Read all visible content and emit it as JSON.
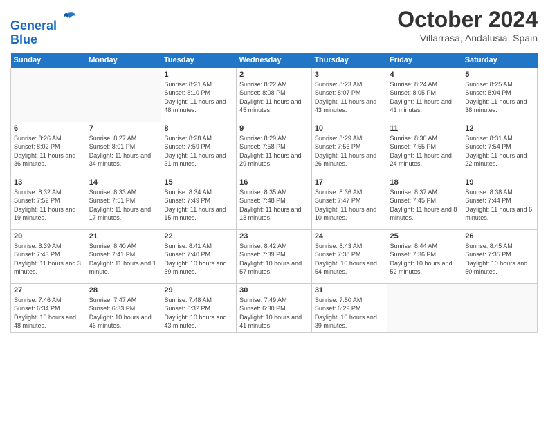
{
  "header": {
    "logo_line1": "General",
    "logo_line2": "Blue",
    "title": "October 2024",
    "subtitle": "Villarrasa, Andalusia, Spain"
  },
  "days_of_week": [
    "Sunday",
    "Monday",
    "Tuesday",
    "Wednesday",
    "Thursday",
    "Friday",
    "Saturday"
  ],
  "weeks": [
    [
      {
        "day": "",
        "info": ""
      },
      {
        "day": "",
        "info": ""
      },
      {
        "day": "1",
        "info": "Sunrise: 8:21 AM\nSunset: 8:10 PM\nDaylight: 11 hours and 48 minutes."
      },
      {
        "day": "2",
        "info": "Sunrise: 8:22 AM\nSunset: 8:08 PM\nDaylight: 11 hours and 45 minutes."
      },
      {
        "day": "3",
        "info": "Sunrise: 8:23 AM\nSunset: 8:07 PM\nDaylight: 11 hours and 43 minutes."
      },
      {
        "day": "4",
        "info": "Sunrise: 8:24 AM\nSunset: 8:05 PM\nDaylight: 11 hours and 41 minutes."
      },
      {
        "day": "5",
        "info": "Sunrise: 8:25 AM\nSunset: 8:04 PM\nDaylight: 11 hours and 38 minutes."
      }
    ],
    [
      {
        "day": "6",
        "info": "Sunrise: 8:26 AM\nSunset: 8:02 PM\nDaylight: 11 hours and 36 minutes."
      },
      {
        "day": "7",
        "info": "Sunrise: 8:27 AM\nSunset: 8:01 PM\nDaylight: 11 hours and 34 minutes."
      },
      {
        "day": "8",
        "info": "Sunrise: 8:28 AM\nSunset: 7:59 PM\nDaylight: 11 hours and 31 minutes."
      },
      {
        "day": "9",
        "info": "Sunrise: 8:29 AM\nSunset: 7:58 PM\nDaylight: 11 hours and 29 minutes."
      },
      {
        "day": "10",
        "info": "Sunrise: 8:29 AM\nSunset: 7:56 PM\nDaylight: 11 hours and 26 minutes."
      },
      {
        "day": "11",
        "info": "Sunrise: 8:30 AM\nSunset: 7:55 PM\nDaylight: 11 hours and 24 minutes."
      },
      {
        "day": "12",
        "info": "Sunrise: 8:31 AM\nSunset: 7:54 PM\nDaylight: 11 hours and 22 minutes."
      }
    ],
    [
      {
        "day": "13",
        "info": "Sunrise: 8:32 AM\nSunset: 7:52 PM\nDaylight: 11 hours and 19 minutes."
      },
      {
        "day": "14",
        "info": "Sunrise: 8:33 AM\nSunset: 7:51 PM\nDaylight: 11 hours and 17 minutes."
      },
      {
        "day": "15",
        "info": "Sunrise: 8:34 AM\nSunset: 7:49 PM\nDaylight: 11 hours and 15 minutes."
      },
      {
        "day": "16",
        "info": "Sunrise: 8:35 AM\nSunset: 7:48 PM\nDaylight: 11 hours and 13 minutes."
      },
      {
        "day": "17",
        "info": "Sunrise: 8:36 AM\nSunset: 7:47 PM\nDaylight: 11 hours and 10 minutes."
      },
      {
        "day": "18",
        "info": "Sunrise: 8:37 AM\nSunset: 7:45 PM\nDaylight: 11 hours and 8 minutes."
      },
      {
        "day": "19",
        "info": "Sunrise: 8:38 AM\nSunset: 7:44 PM\nDaylight: 11 hours and 6 minutes."
      }
    ],
    [
      {
        "day": "20",
        "info": "Sunrise: 8:39 AM\nSunset: 7:43 PM\nDaylight: 11 hours and 3 minutes."
      },
      {
        "day": "21",
        "info": "Sunrise: 8:40 AM\nSunset: 7:41 PM\nDaylight: 11 hours and 1 minute."
      },
      {
        "day": "22",
        "info": "Sunrise: 8:41 AM\nSunset: 7:40 PM\nDaylight: 10 hours and 59 minutes."
      },
      {
        "day": "23",
        "info": "Sunrise: 8:42 AM\nSunset: 7:39 PM\nDaylight: 10 hours and 57 minutes."
      },
      {
        "day": "24",
        "info": "Sunrise: 8:43 AM\nSunset: 7:38 PM\nDaylight: 10 hours and 54 minutes."
      },
      {
        "day": "25",
        "info": "Sunrise: 8:44 AM\nSunset: 7:36 PM\nDaylight: 10 hours and 52 minutes."
      },
      {
        "day": "26",
        "info": "Sunrise: 8:45 AM\nSunset: 7:35 PM\nDaylight: 10 hours and 50 minutes."
      }
    ],
    [
      {
        "day": "27",
        "info": "Sunrise: 7:46 AM\nSunset: 6:34 PM\nDaylight: 10 hours and 48 minutes."
      },
      {
        "day": "28",
        "info": "Sunrise: 7:47 AM\nSunset: 6:33 PM\nDaylight: 10 hours and 46 minutes."
      },
      {
        "day": "29",
        "info": "Sunrise: 7:48 AM\nSunset: 6:32 PM\nDaylight: 10 hours and 43 minutes."
      },
      {
        "day": "30",
        "info": "Sunrise: 7:49 AM\nSunset: 6:30 PM\nDaylight: 10 hours and 41 minutes."
      },
      {
        "day": "31",
        "info": "Sunrise: 7:50 AM\nSunset: 6:29 PM\nDaylight: 10 hours and 39 minutes."
      },
      {
        "day": "",
        "info": ""
      },
      {
        "day": "",
        "info": ""
      }
    ]
  ]
}
